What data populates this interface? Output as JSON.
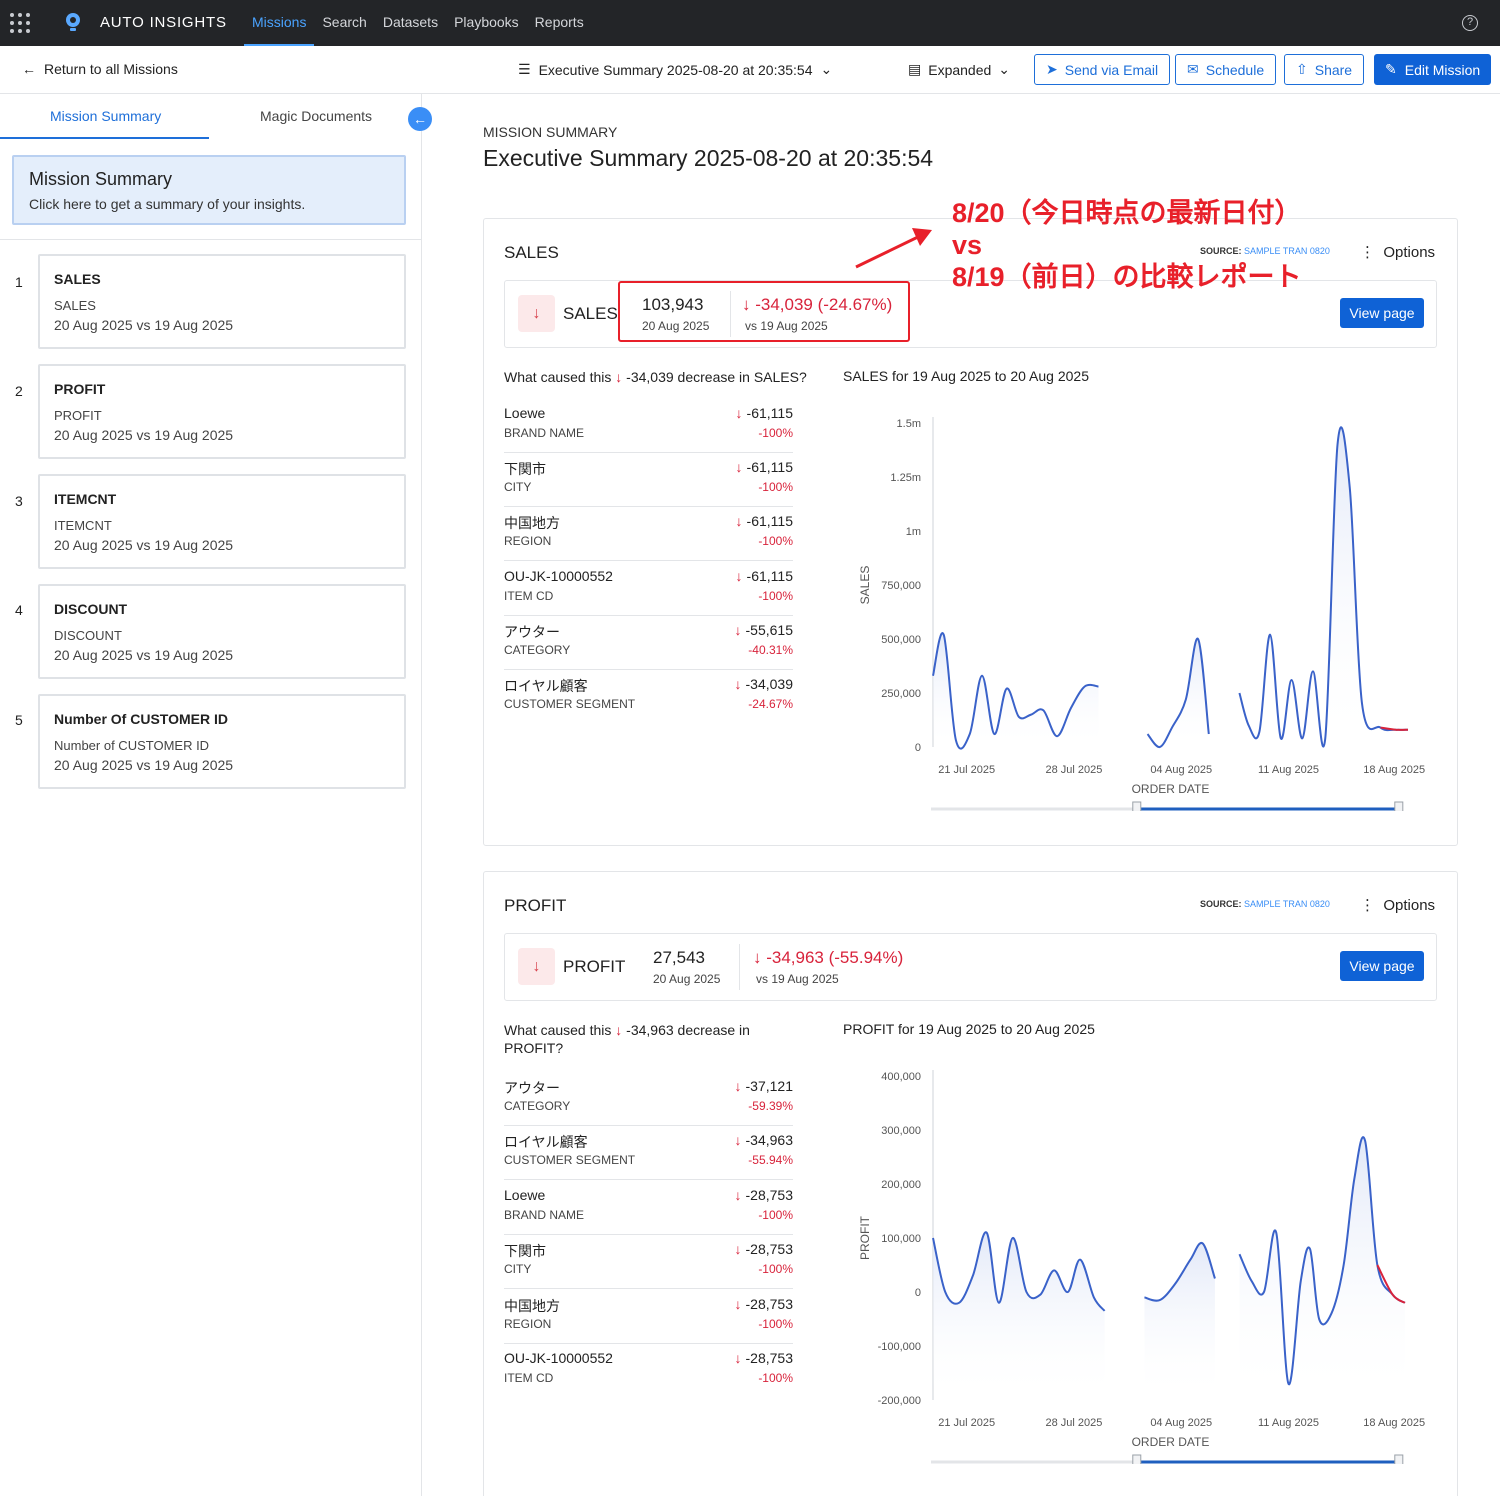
{
  "app": {
    "brand": "AUTO INSIGHTS",
    "nav": [
      "Missions",
      "Search",
      "Datasets",
      "Playbooks",
      "Reports"
    ],
    "active_nav": "Missions",
    "icons": {
      "apps": "apps-grid-icon",
      "logo": "lightbulb-logo-icon",
      "help": "help-icon"
    }
  },
  "subheader": {
    "back_label": "Return to all Missions",
    "doc_title": "Executive Summary 2025-08-20 at 20:35:54",
    "view_mode": "Expanded",
    "send_email": "Send via Email",
    "schedule": "Schedule",
    "share": "Share",
    "edit": "Edit Mission"
  },
  "sidebar": {
    "tab_summary": "Mission Summary",
    "tab_magic": "Magic Documents",
    "summary_card": {
      "title": "Mission Summary",
      "subtitle": "Click here to get a summary of your insights."
    },
    "items": [
      {
        "num": "1",
        "title": "SALES",
        "sub": "SALES",
        "dates": "20 Aug 2025 vs 19 Aug 2025"
      },
      {
        "num": "2",
        "title": "PROFIT",
        "sub": "PROFIT",
        "dates": "20 Aug 2025 vs 19 Aug 2025"
      },
      {
        "num": "3",
        "title": "ITEMCNT",
        "sub": "ITEMCNT",
        "dates": "20 Aug 2025 vs 19 Aug 2025"
      },
      {
        "num": "4",
        "title": "DISCOUNT",
        "sub": "DISCOUNT",
        "dates": "20 Aug 2025 vs 19 Aug 2025"
      },
      {
        "num": "5",
        "title": "Number Of CUSTOMER ID",
        "sub": "Number of CUSTOMER ID",
        "dates": "20 Aug 2025 vs 19 Aug 2025"
      }
    ]
  },
  "main": {
    "kicker": "MISSION SUMMARY",
    "title": "Executive Summary 2025-08-20 at 20:35:54",
    "annotation": [
      "8/20（今日時点の最新日付）",
      "vs",
      "8/19（前日）の比較レポート"
    ],
    "source_label": "SOURCE:",
    "source_name": "SAMPLE TRAN 0820",
    "options_label": "Options",
    "view_page": "View page",
    "sales": {
      "header": "SALES",
      "metric_name": "SALES",
      "value": "103,943",
      "value_date": "20 Aug 2025",
      "change": "-34,039 (-24.67%)",
      "change_date": "vs 19 Aug 2025",
      "cause_prefix": "What caused this",
      "cause_value": "-34,039 decrease in SALES?",
      "drivers": [
        {
          "name": "Loewe",
          "type": "BRAND NAME",
          "value": "-61,115",
          "pct": "-100%"
        },
        {
          "name": "下関市",
          "type": "CITY",
          "value": "-61,115",
          "pct": "-100%"
        },
        {
          "name": "中国地方",
          "type": "REGION",
          "value": "-61,115",
          "pct": "-100%"
        },
        {
          "name": "OU-JK-10000552",
          "type": "ITEM CD",
          "value": "-61,115",
          "pct": "-100%"
        },
        {
          "name": "アウター",
          "type": "CATEGORY",
          "value": "-55,615",
          "pct": "-40.31%"
        },
        {
          "name": "ロイヤル顧客",
          "type": "CUSTOMER SEGMENT",
          "value": "-34,039",
          "pct": "-24.67%"
        }
      ],
      "chart_title": "SALES for 19 Aug 2025 to 20 Aug 2025"
    },
    "profit": {
      "header": "PROFIT",
      "metric_name": "PROFIT",
      "value": "27,543",
      "value_date": "20 Aug 2025",
      "change": "-34,963 (-55.94%)",
      "change_date": "vs 19 Aug 2025",
      "cause_prefix": "What caused this",
      "cause_value": "-34,963 decrease in",
      "cause_suffix": "PROFIT?",
      "drivers": [
        {
          "name": "アウター",
          "type": "CATEGORY",
          "value": "-37,121",
          "pct": "-59.39%"
        },
        {
          "name": "ロイヤル顧客",
          "type": "CUSTOMER SEGMENT",
          "value": "-34,963",
          "pct": "-55.94%"
        },
        {
          "name": "Loewe",
          "type": "BRAND NAME",
          "value": "-28,753",
          "pct": "-100%"
        },
        {
          "name": "下関市",
          "type": "CITY",
          "value": "-28,753",
          "pct": "-100%"
        },
        {
          "name": "中国地方",
          "type": "REGION",
          "value": "-28,753",
          "pct": "-100%"
        },
        {
          "name": "OU-JK-10000552",
          "type": "ITEM CD",
          "value": "-28,753",
          "pct": "-100%"
        }
      ],
      "chart_title": "PROFIT for 19 Aug 2025 to 20 Aug 2025"
    }
  },
  "chart_data": [
    {
      "type": "line",
      "title": "SALES for 19 Aug 2025 to 20 Aug 2025",
      "xlabel": "ORDER DATE",
      "ylabel": "SALES",
      "ylim": [
        0,
        1500000
      ],
      "yticks": [
        "0",
        "250,000",
        "500,000",
        "750,000",
        "1m",
        "1.25m",
        "1.5m"
      ],
      "ytick_values": [
        0,
        250000,
        500000,
        750000,
        1000000,
        1250000,
        1500000
      ],
      "xticks": [
        "21 Jul 2025",
        "28 Jul 2025",
        "04 Aug 2025",
        "11 Aug 2025",
        "18 Aug 2025"
      ],
      "xlim": [
        0,
        31
      ],
      "highlight_color": "#d8233b",
      "line_color": "#3a62c9",
      "segments": [
        {
          "x": [
            0,
            0.7,
            1.5,
            2.4,
            3.2,
            4,
            4.8,
            5.6,
            6.4,
            7.2,
            8.1,
            9,
            9.9,
            10.8
          ],
          "y": [
            330000,
            520000,
            30000,
            60000,
            330000,
            60000,
            270000,
            140000,
            150000,
            170000,
            50000,
            180000,
            280000,
            280000
          ]
        },
        {
          "x": [
            14,
            14.8,
            15.6,
            16.5,
            17.3,
            18
          ],
          "y": [
            60000,
            0,
            90000,
            220000,
            500000,
            60000
          ]
        },
        {
          "x": [
            20,
            20.6,
            21.3,
            22,
            22.7,
            23.4,
            24.1,
            24.8,
            25.6,
            26.4,
            27.2,
            28,
            29.2,
            30.2,
            31
          ],
          "y": [
            250000,
            100000,
            70000,
            520000,
            40000,
            310000,
            40000,
            350000,
            40000,
            1400000,
            1200000,
            200000,
            90000,
            80000,
            80000
          ]
        }
      ]
    },
    {
      "type": "line",
      "title": "PROFIT for 19 Aug 2025 to 20 Aug 2025",
      "xlabel": "ORDER DATE",
      "ylabel": "PROFIT",
      "ylim": [
        -200000,
        400000
      ],
      "yticks": [
        "-200,000",
        "-100,000",
        "0",
        "100,000",
        "200,000",
        "300,000",
        "400,000"
      ],
      "ytick_values": [
        -200000,
        -100000,
        0,
        100000,
        200000,
        300000,
        400000
      ],
      "xticks": [
        "21 Jul 2025",
        "28 Jul 2025",
        "04 Aug 2025",
        "11 Aug 2025",
        "18 Aug 2025"
      ],
      "xlim": [
        0,
        31
      ],
      "highlight_color": "#d8233b",
      "line_color": "#3a62c9",
      "segments": [
        {
          "x": [
            0,
            0.8,
            1.7,
            2.6,
            3.5,
            4.3,
            5.2,
            6.1,
            7,
            7.9,
            8.8,
            9.6,
            10.5,
            11.2
          ],
          "y": [
            100000,
            0,
            -20000,
            30000,
            110000,
            -20000,
            100000,
            0,
            -5000,
            40000,
            0,
            60000,
            -10000,
            -35000
          ]
        },
        {
          "x": [
            13.8,
            14.8,
            15.8,
            16.8,
            17.6,
            18.4
          ],
          "y": [
            -10000,
            -15000,
            15000,
            60000,
            90000,
            25000
          ]
        },
        {
          "x": [
            20,
            20.8,
            21.6,
            22.4,
            23.2,
            24,
            24.6,
            25.2,
            26,
            26.8,
            27.5,
            28.2,
            29,
            30,
            30.8
          ],
          "y": [
            70000,
            20000,
            0,
            110000,
            -170000,
            20000,
            80000,
            -50000,
            -40000,
            50000,
            210000,
            280000,
            50000,
            -5000,
            -20000
          ]
        }
      ]
    }
  ]
}
